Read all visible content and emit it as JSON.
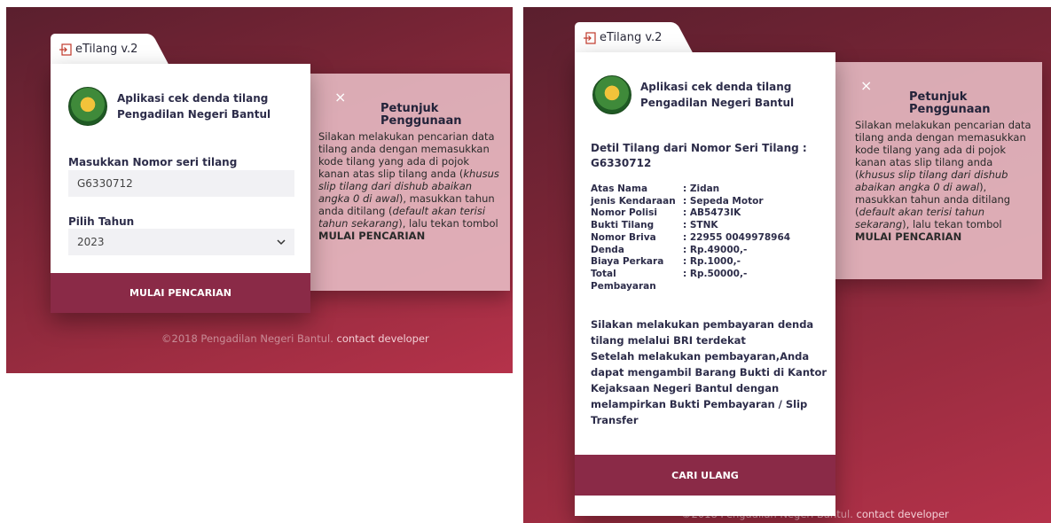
{
  "brand": {
    "label": "eTilang v.2"
  },
  "app": {
    "title_line1": "Aplikasi cek denda tilang",
    "title_line2": "Pengadilan Negeri Bantul"
  },
  "form": {
    "nomor_label": "Masukkan Nomor seri tilang",
    "nomor_value": "G6330712",
    "tahun_label": "Pilih Tahun",
    "tahun_value": "2023",
    "submit_label": "MULAI PENCARIAN"
  },
  "help": {
    "close_glyph": "×",
    "title": "Petunjuk Penggunaan",
    "p1": "Silakan melakukan pencarian data tilang anda dengan memasukkan kode tilang yang ada di pojok kanan atas slip tilang anda (",
    "p1_em": "khusus slip tilang dari dishub abaikan angka 0 di awal",
    "p2": "), masukkan tahun anda ditilang (",
    "p2_em": "default akan terisi tahun sekarang",
    "p3": "), lalu tekan tombol ",
    "p3_bold": "MULAI PENCARIAN"
  },
  "footer": {
    "text": "©2018 Pengadilan Negeri Bantul.",
    "link": "contact developer"
  },
  "detail": {
    "heading": "Detil Tilang dari Nomor Seri Tilang :",
    "nomor": "G6330712",
    "rows": [
      {
        "key": "Atas Nama",
        "value": ": Zidan"
      },
      {
        "key": "jenis Kendaraan",
        "value": ": Sepeda Motor"
      },
      {
        "key": "Nomor Polisi",
        "value": ": AB5473IK"
      },
      {
        "key": "Bukti Tilang",
        "value": ": STNK"
      },
      {
        "key": "Nomor Briva",
        "value": ": 22955 0049978964"
      },
      {
        "key": "Denda",
        "value": ": Rp.49000,-"
      },
      {
        "key": "Biaya Perkara",
        "value": ": Rp.1000,-"
      },
      {
        "key": "Total Pembayaran",
        "value": ": Rp.50000,-"
      }
    ],
    "info_lines": [
      "Silakan melakukan pembayaran denda",
      "tilang melalui BRI terdekat",
      "Setelah melakukan pembayaran,Anda",
      "dapat mengambil Barang Bukti di Kantor",
      "Kejaksaan Negeri Bantul dengan",
      "melampirkan Bukti Pembayaran / Slip",
      "Transfer"
    ],
    "retry_label": "CARI ULANG"
  },
  "colors": {
    "accent": "#8a2a47",
    "bg_dark": "#5a1f2e",
    "bg_light": "#b5324a",
    "help_bg": "#e8bec6"
  },
  "icons": {
    "brand": "login-icon",
    "select": "chevron-down-icon",
    "close": "close-icon",
    "logo": "court-logo"
  }
}
